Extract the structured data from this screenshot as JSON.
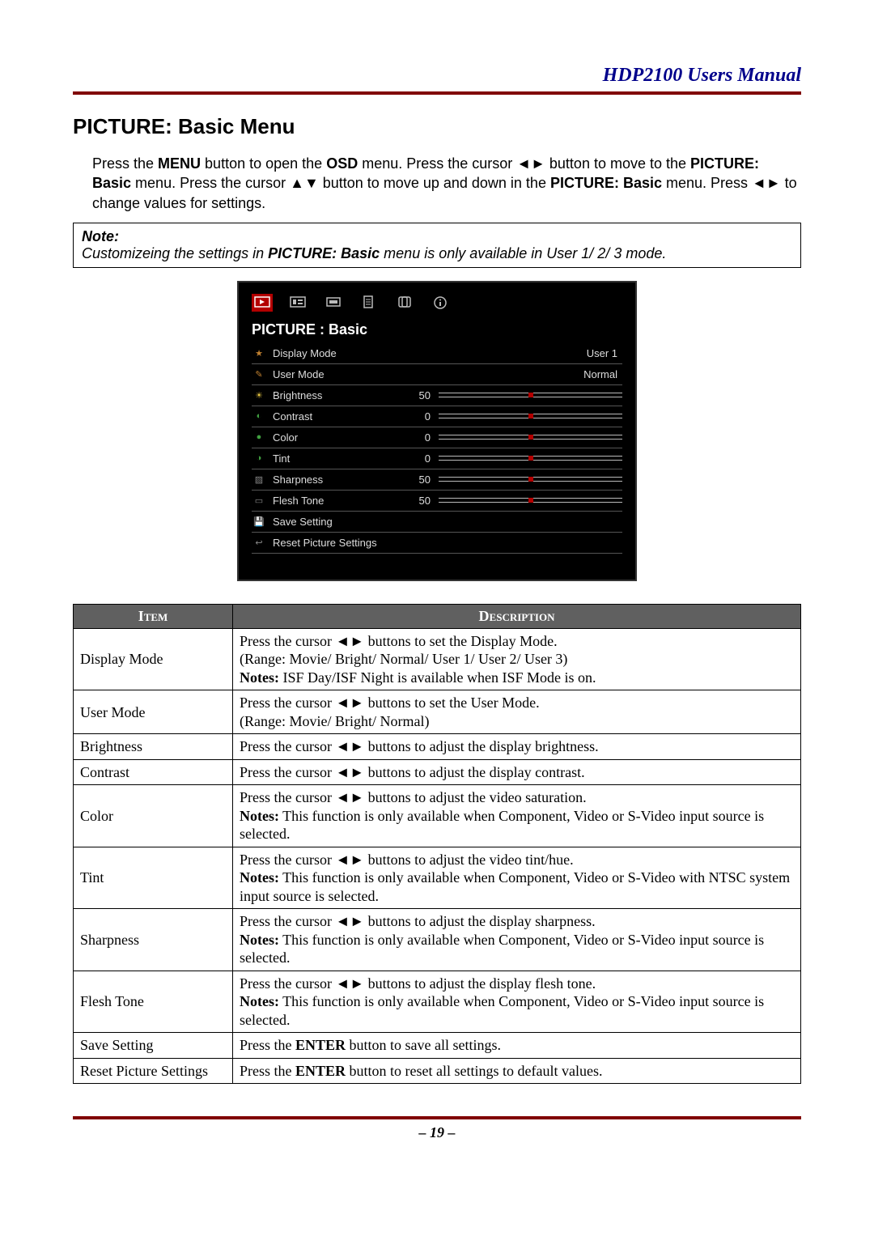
{
  "header": {
    "manual_title": "HDP2100 Users Manual"
  },
  "section": {
    "title": "PICTURE: Basic Menu",
    "intro_html": "Press the <b>MENU</b> button to open the <b>OSD</b> menu. Press the cursor ◄► button to move to the <b>PICTURE: Basic</b> menu. Press the cursor ▲▼ button to move up and down in the <b>PICTURE: Basic</b> menu. Press ◄► to change values for settings."
  },
  "note": {
    "head": "Note:",
    "body_html": "Customizeing the settings in <b>PICTURE: Basic</b> menu is only available in User 1/ 2/ 3 mode."
  },
  "osd": {
    "title": "PICTURE : Basic",
    "tabs": [
      "picture",
      "picture-adv",
      "display",
      "setup",
      "option",
      "info"
    ],
    "active_tab": 0,
    "rows": [
      {
        "icon": "display-mode-icon",
        "label": "Display Mode",
        "type": "text",
        "value": "User 1"
      },
      {
        "icon": "user-mode-icon",
        "label": "User Mode",
        "type": "text",
        "value": "Normal"
      },
      {
        "icon": "brightness-icon",
        "label": "Brightness",
        "type": "slider",
        "value": 50,
        "pct": 50
      },
      {
        "icon": "contrast-icon",
        "label": "Contrast",
        "type": "slider",
        "value": 0,
        "pct": 50
      },
      {
        "icon": "color-icon",
        "label": "Color",
        "type": "slider",
        "value": 0,
        "pct": 50
      },
      {
        "icon": "tint-icon",
        "label": "Tint",
        "type": "slider",
        "value": 0,
        "pct": 50
      },
      {
        "icon": "sharpness-icon",
        "label": "Sharpness",
        "type": "slider",
        "value": 50,
        "pct": 50
      },
      {
        "icon": "flesh-tone-icon",
        "label": "Flesh Tone",
        "type": "slider",
        "value": 50,
        "pct": 50
      },
      {
        "icon": "save-icon",
        "label": "Save Setting",
        "type": "action"
      },
      {
        "icon": "reset-icon",
        "label": "Reset Picture Settings",
        "type": "action"
      }
    ]
  },
  "table": {
    "headers": {
      "item": "Item",
      "desc": "Description"
    },
    "rows": [
      {
        "item": "Display Mode",
        "desc_html": "Press the cursor ◄► buttons to set the Display Mode.<br>(Range: Movie/ Bright/ Normal/ User 1/ User 2/ User 3)<br><b>Notes:</b> ISF Day/ISF Night is available when ISF Mode is on."
      },
      {
        "item": "User Mode",
        "desc_html": "Press the cursor ◄► buttons to set the User Mode.<br>(Range: Movie/ Bright/ Normal)"
      },
      {
        "item": "Brightness",
        "desc_html": "Press the cursor ◄► buttons to adjust the display brightness."
      },
      {
        "item": "Contrast",
        "desc_html": "Press the cursor ◄► buttons to adjust the display contrast."
      },
      {
        "item": "Color",
        "desc_html": "Press the cursor ◄► buttons to adjust the video saturation.<br><b>Notes:</b> This function is only available when Component, Video or S-Video input source is selected."
      },
      {
        "item": "Tint",
        "desc_html": "Press the cursor ◄► buttons to adjust the video tint/hue.<br><b>Notes:</b> This function is only available when Component, Video or S-Video with NTSC system input source is selected."
      },
      {
        "item": "Sharpness",
        "desc_html": "Press the cursor ◄► buttons to adjust the display sharpness.<br><b>Notes:</b> This function is only available when Component, Video or S-Video input source is selected."
      },
      {
        "item": "Flesh Tone",
        "desc_html": "Press the cursor ◄► buttons to adjust the display flesh tone.<br><b>Notes:</b> This function is only available when Component, Video or S-Video input source is selected."
      },
      {
        "item": "Save Setting",
        "desc_html": "Press the <b>ENTER</b> button to save all settings."
      },
      {
        "item": "Reset Picture Settings",
        "desc_html": "Press the <b>ENTER</b> button to reset all settings to default values."
      }
    ]
  },
  "footer": {
    "page": "– 19 –"
  }
}
